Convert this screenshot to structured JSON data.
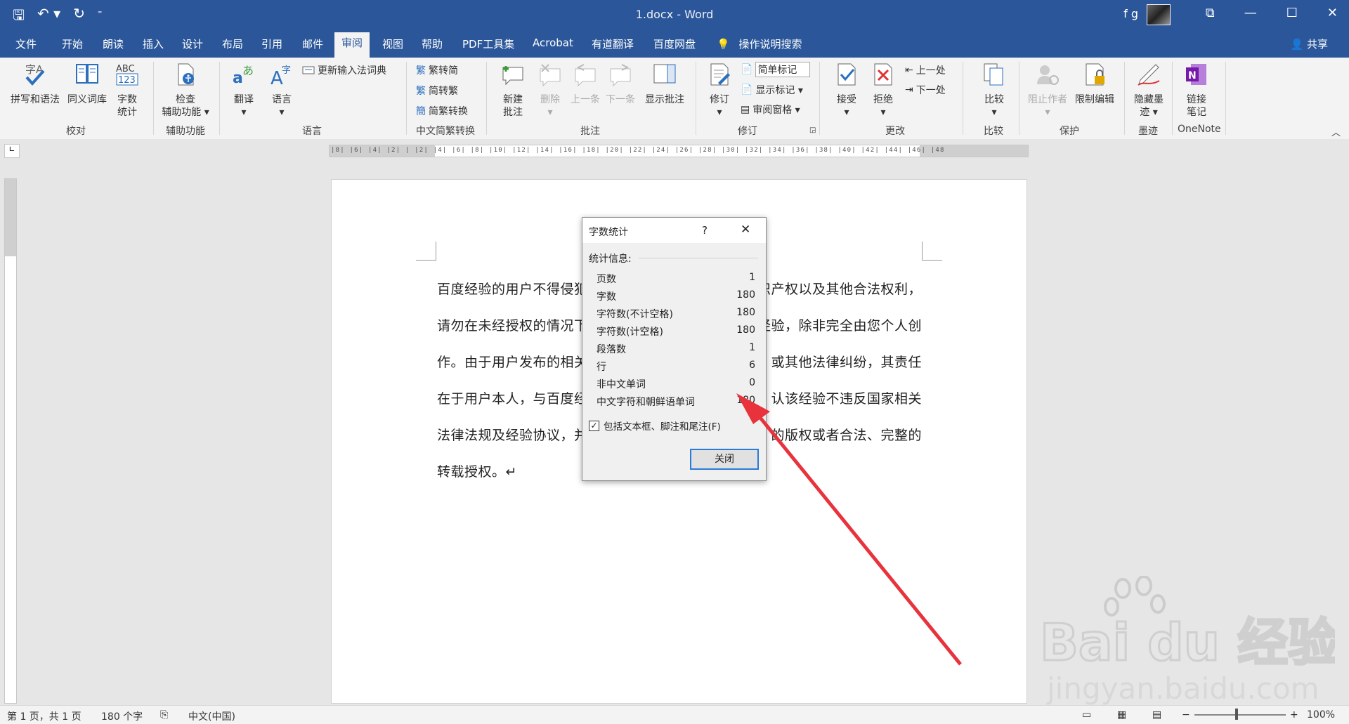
{
  "window": {
    "title": "1.docx  -  Word",
    "user": "f g"
  },
  "tabs": [
    "文件",
    "开始",
    "朗读",
    "插入",
    "设计",
    "布局",
    "引用",
    "邮件",
    "审阅",
    "视图",
    "帮助",
    "PDF工具集",
    "Acrobat",
    "有道翻译",
    "百度网盘"
  ],
  "tell_me": "操作说明搜索",
  "share": "共享",
  "ribbon": {
    "groups": {
      "proofing": "校对",
      "accessibility": "辅助功能",
      "language": "语言",
      "chinese_conversion": "中文简繁转换",
      "comments": "批注",
      "tracking": "修订",
      "changes": "更改",
      "compare": "比较",
      "protect": "保护",
      "ink": "墨迹",
      "onenote": "OneNote"
    },
    "buttons": {
      "spelling": "拼写和语法",
      "thesaurus": "同义词库",
      "wordcount_1": "字数",
      "wordcount_2": "统计",
      "check_1": "检查",
      "check_2": "辅助功能 ▾",
      "translate": "翻译",
      "language": "语言",
      "update_ime": "更新输入法词典",
      "to_traditional": "繁转简",
      "to_simplified": "简转繁",
      "conversion": "简繁转换",
      "new_comment_1": "新建",
      "new_comment_2": "批注",
      "delete": "删除",
      "previous": "上一条",
      "next": "下一条",
      "show_comments": "显示批注",
      "track": "修订",
      "simple_markup": "简单标记",
      "show_markup": "显示标记 ▾",
      "review_pane": "审阅窗格 ▾",
      "accept": "接受",
      "reject": "拒绝",
      "prev_change": "上一处",
      "next_change": "下一处",
      "compare": "比较",
      "block_authors": "阻止作者",
      "restrict": "限制编辑",
      "hide_ink_1": "隐藏墨",
      "hide_ink_2": "迹 ▾",
      "link_notes_1": "链接",
      "link_notes_2": "笔记"
    }
  },
  "document": {
    "lines": [
      "百度经验的用户不得侵犯",
      "请勿在未经授权的情况下",
      "作。由于用户发布的相关",
      "在于用户本人，与百度经",
      "法律法规及经验协议，并",
      "转载授权。↵"
    ],
    "lines_right": [
      "识产权以及其他合法权利，",
      "经验，除非完全由您个人创",
      "或其他法律纠纷，其责任",
      "认该经验不违反国家相关",
      "的版权或者合法、完整的",
      ""
    ]
  },
  "dialog": {
    "title": "字数统计",
    "help": "?",
    "section": "统计信息:",
    "stats": [
      {
        "label": "页数",
        "value": "1"
      },
      {
        "label": "字数",
        "value": "180"
      },
      {
        "label": "字符数(不计空格)",
        "value": "180"
      },
      {
        "label": "字符数(计空格)",
        "value": "180"
      },
      {
        "label": "段落数",
        "value": "1"
      },
      {
        "label": "行",
        "value": "6"
      },
      {
        "label": "非中文单词",
        "value": "0"
      },
      {
        "label": "中文字符和朝鲜语单词",
        "value": "180"
      }
    ],
    "checkbox_label": "包括文本框、脚注和尾注(F)",
    "checkbox_checked": true,
    "close_button": "关闭"
  },
  "status": {
    "page": "第 1 页，共 1 页",
    "words": "180 个字",
    "language": "中文(中国)",
    "zoom": "100%"
  },
  "watermark": {
    "brand": "Bai du 经验",
    "url": "jingyan.baidu.com"
  },
  "colors": {
    "ribbon_blue": "#2b579a",
    "arrow_red": "#e8323c"
  }
}
